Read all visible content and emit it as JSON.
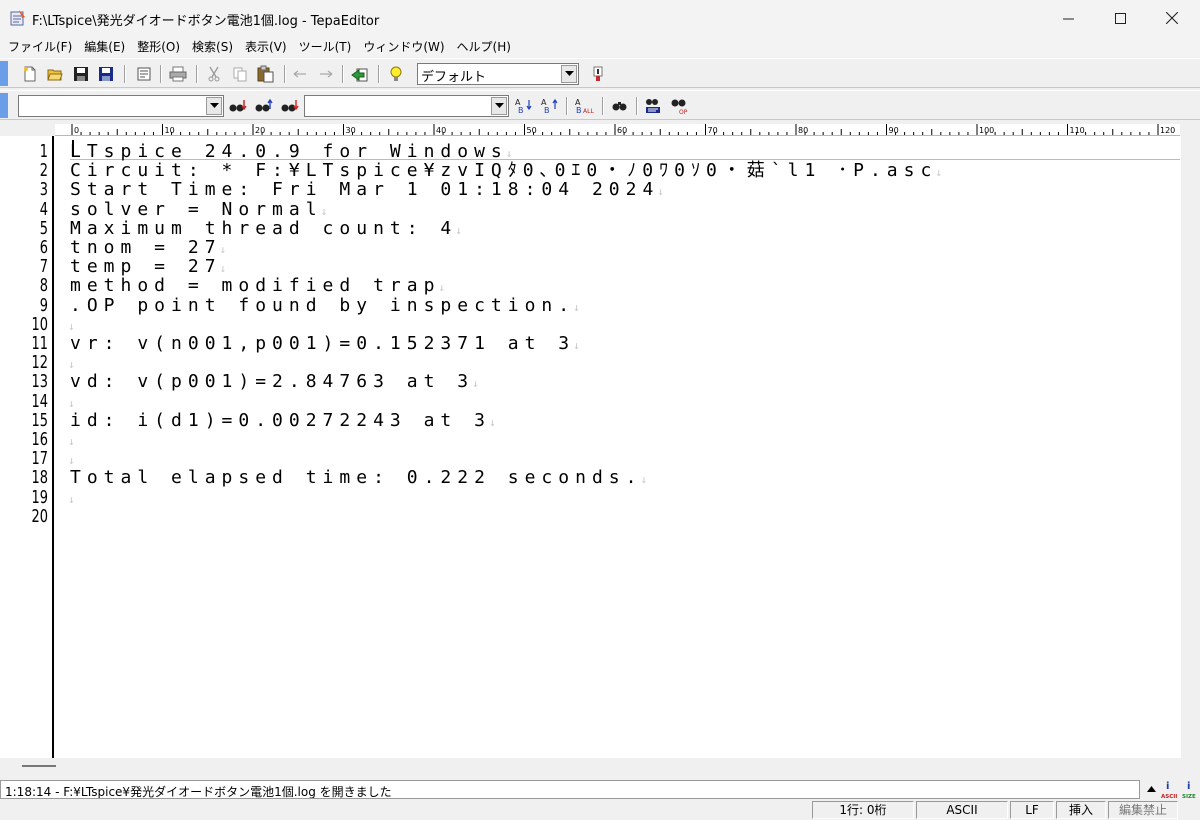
{
  "window": {
    "title": "F:\\LTspice\\発光ダイオードボタン電池1個.log - TepaEditor"
  },
  "menu": [
    "ファイル(F)",
    "編集(E)",
    "整形(O)",
    "検索(S)",
    "表示(V)",
    "ツール(T)",
    "ウィンドウ(W)",
    "ヘルプ(H)"
  ],
  "toolbar1": {
    "mode_combo": "デフォルト"
  },
  "toolbar2": {
    "search_combo": "",
    "replace_combo": ""
  },
  "ruler": {
    "labels": [
      "0",
      "10",
      "20",
      "30",
      "40",
      "50",
      "60",
      "70",
      "80",
      "90",
      "100",
      "110",
      "120"
    ]
  },
  "editor": {
    "line_numbers": [
      "1",
      "2",
      "3",
      "4",
      "5",
      "6",
      "7",
      "8",
      "9",
      "10",
      "11",
      "12",
      "13",
      "14",
      "15",
      "16",
      "17",
      "18",
      "19",
      "20"
    ],
    "lines": [
      "LTspice 24.0.9 for Windows",
      " Circuit: * F:¥LTspice¥zvIQﾀ0､0ｴ0・ﾉ0ﾜ0ｿ0・菇`l1 ･P.asc",
      " Start Time: Fri Mar  1 01:18:04 2024",
      " solver = Normal",
      " Maximum thread count: 4",
      " tnom = 27",
      " temp = 27",
      " method = modified trap",
      " .OP point found by inspection.",
      "",
      " vr: v(n001,p001)=0.152371 at 3",
      "",
      " vd: v(p001)=2.84763 at 3",
      "",
      " id: i(d1)=0.00272243 at 3",
      "",
      "",
      " Total elapsed time: 0.222 seconds.",
      "",
      ""
    ],
    "eol_mark": "↓"
  },
  "message": "1:18:14 - F:¥LTspice¥発光ダイオードボタン電池1個.log を開きました",
  "status": {
    "position": "1行: 0桁",
    "encoding": "ASCII",
    "newline": "LF",
    "insert_mode": "挿入",
    "edit_lock": "編集禁止"
  },
  "status_icons": {
    "ascii_label": "ASCII",
    "size_label": "SIZE"
  }
}
